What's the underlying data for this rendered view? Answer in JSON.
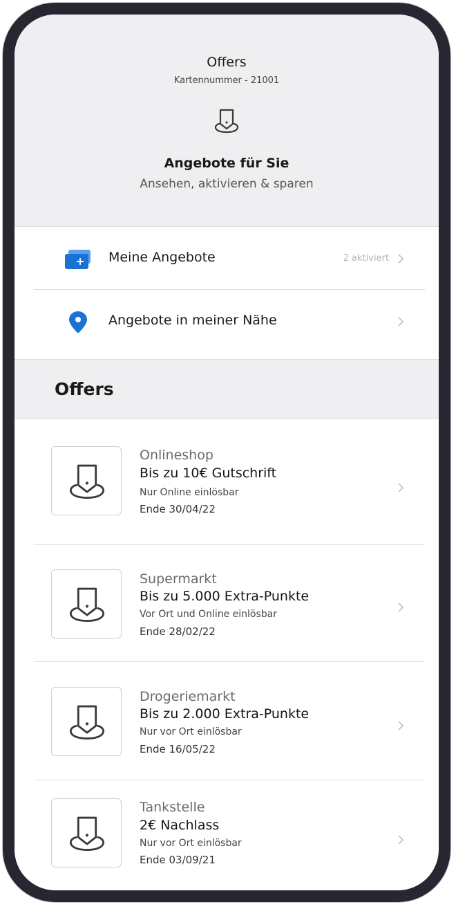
{
  "header": {
    "title": "Offers",
    "card_number": "Kartennummer - 21001",
    "icon": "offer-tag-icon",
    "heading": "Angebote für Sie",
    "tagline": "Ansehen, aktivieren & sparen"
  },
  "nav": [
    {
      "label": "Meine Angebote",
      "badge": "2 aktiviert",
      "icon": "card-plus-icon"
    },
    {
      "label": "Angebote in meiner Nähe",
      "badge": "",
      "icon": "location-pin-icon"
    }
  ],
  "section": {
    "title": "Offers"
  },
  "offers": [
    {
      "category": "Onlineshop",
      "title": "Bis zu 10€ Gutschrift",
      "condition": "Nur Online einlösbar",
      "end": "Ende 30/04/22"
    },
    {
      "category": "Supermarkt",
      "title": "Bis zu 5.000 Extra-Punkte",
      "condition": "Vor Ort und Online einlösbar",
      "end": "Ende 28/02/22"
    },
    {
      "category": "Drogeriemarkt",
      "title": "Bis zu 2.000 Extra-Punkte",
      "condition": "Nur vor Ort einlösbar",
      "end": "Ende 16/05/22"
    },
    {
      "category": "Tankstelle",
      "title": "2€ Nachlass",
      "condition": "Nur vor Ort einlösbar",
      "end": "Ende 03/09/21"
    }
  ],
  "colors": {
    "accent": "#1a73d4",
    "header_bg": "#efeff1",
    "frame": "#272732"
  }
}
